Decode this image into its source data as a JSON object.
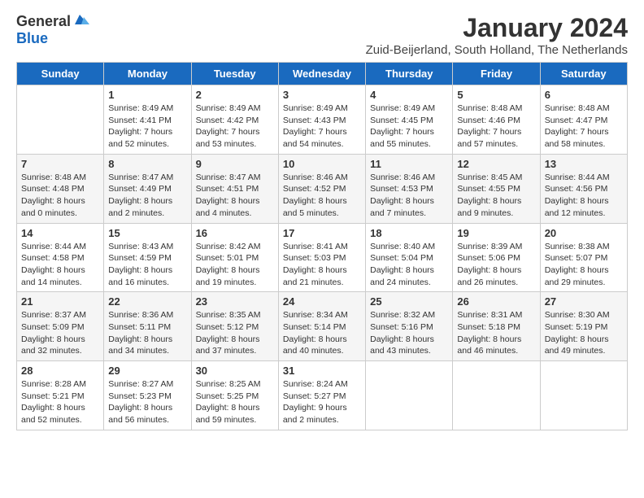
{
  "header": {
    "logo_general": "General",
    "logo_blue": "Blue",
    "month_title": "January 2024",
    "location": "Zuid-Beijerland, South Holland, The Netherlands"
  },
  "weekdays": [
    "Sunday",
    "Monday",
    "Tuesday",
    "Wednesday",
    "Thursday",
    "Friday",
    "Saturday"
  ],
  "weeks": [
    [
      {
        "day": "",
        "sunrise": "",
        "sunset": "",
        "daylight": ""
      },
      {
        "day": "1",
        "sunrise": "Sunrise: 8:49 AM",
        "sunset": "Sunset: 4:41 PM",
        "daylight": "Daylight: 7 hours and 52 minutes."
      },
      {
        "day": "2",
        "sunrise": "Sunrise: 8:49 AM",
        "sunset": "Sunset: 4:42 PM",
        "daylight": "Daylight: 7 hours and 53 minutes."
      },
      {
        "day": "3",
        "sunrise": "Sunrise: 8:49 AM",
        "sunset": "Sunset: 4:43 PM",
        "daylight": "Daylight: 7 hours and 54 minutes."
      },
      {
        "day": "4",
        "sunrise": "Sunrise: 8:49 AM",
        "sunset": "Sunset: 4:45 PM",
        "daylight": "Daylight: 7 hours and 55 minutes."
      },
      {
        "day": "5",
        "sunrise": "Sunrise: 8:48 AM",
        "sunset": "Sunset: 4:46 PM",
        "daylight": "Daylight: 7 hours and 57 minutes."
      },
      {
        "day": "6",
        "sunrise": "Sunrise: 8:48 AM",
        "sunset": "Sunset: 4:47 PM",
        "daylight": "Daylight: 7 hours and 58 minutes."
      }
    ],
    [
      {
        "day": "7",
        "sunrise": "Sunrise: 8:48 AM",
        "sunset": "Sunset: 4:48 PM",
        "daylight": "Daylight: 8 hours and 0 minutes."
      },
      {
        "day": "8",
        "sunrise": "Sunrise: 8:47 AM",
        "sunset": "Sunset: 4:49 PM",
        "daylight": "Daylight: 8 hours and 2 minutes."
      },
      {
        "day": "9",
        "sunrise": "Sunrise: 8:47 AM",
        "sunset": "Sunset: 4:51 PM",
        "daylight": "Daylight: 8 hours and 4 minutes."
      },
      {
        "day": "10",
        "sunrise": "Sunrise: 8:46 AM",
        "sunset": "Sunset: 4:52 PM",
        "daylight": "Daylight: 8 hours and 5 minutes."
      },
      {
        "day": "11",
        "sunrise": "Sunrise: 8:46 AM",
        "sunset": "Sunset: 4:53 PM",
        "daylight": "Daylight: 8 hours and 7 minutes."
      },
      {
        "day": "12",
        "sunrise": "Sunrise: 8:45 AM",
        "sunset": "Sunset: 4:55 PM",
        "daylight": "Daylight: 8 hours and 9 minutes."
      },
      {
        "day": "13",
        "sunrise": "Sunrise: 8:44 AM",
        "sunset": "Sunset: 4:56 PM",
        "daylight": "Daylight: 8 hours and 12 minutes."
      }
    ],
    [
      {
        "day": "14",
        "sunrise": "Sunrise: 8:44 AM",
        "sunset": "Sunset: 4:58 PM",
        "daylight": "Daylight: 8 hours and 14 minutes."
      },
      {
        "day": "15",
        "sunrise": "Sunrise: 8:43 AM",
        "sunset": "Sunset: 4:59 PM",
        "daylight": "Daylight: 8 hours and 16 minutes."
      },
      {
        "day": "16",
        "sunrise": "Sunrise: 8:42 AM",
        "sunset": "Sunset: 5:01 PM",
        "daylight": "Daylight: 8 hours and 19 minutes."
      },
      {
        "day": "17",
        "sunrise": "Sunrise: 8:41 AM",
        "sunset": "Sunset: 5:03 PM",
        "daylight": "Daylight: 8 hours and 21 minutes."
      },
      {
        "day": "18",
        "sunrise": "Sunrise: 8:40 AM",
        "sunset": "Sunset: 5:04 PM",
        "daylight": "Daylight: 8 hours and 24 minutes."
      },
      {
        "day": "19",
        "sunrise": "Sunrise: 8:39 AM",
        "sunset": "Sunset: 5:06 PM",
        "daylight": "Daylight: 8 hours and 26 minutes."
      },
      {
        "day": "20",
        "sunrise": "Sunrise: 8:38 AM",
        "sunset": "Sunset: 5:07 PM",
        "daylight": "Daylight: 8 hours and 29 minutes."
      }
    ],
    [
      {
        "day": "21",
        "sunrise": "Sunrise: 8:37 AM",
        "sunset": "Sunset: 5:09 PM",
        "daylight": "Daylight: 8 hours and 32 minutes."
      },
      {
        "day": "22",
        "sunrise": "Sunrise: 8:36 AM",
        "sunset": "Sunset: 5:11 PM",
        "daylight": "Daylight: 8 hours and 34 minutes."
      },
      {
        "day": "23",
        "sunrise": "Sunrise: 8:35 AM",
        "sunset": "Sunset: 5:12 PM",
        "daylight": "Daylight: 8 hours and 37 minutes."
      },
      {
        "day": "24",
        "sunrise": "Sunrise: 8:34 AM",
        "sunset": "Sunset: 5:14 PM",
        "daylight": "Daylight: 8 hours and 40 minutes."
      },
      {
        "day": "25",
        "sunrise": "Sunrise: 8:32 AM",
        "sunset": "Sunset: 5:16 PM",
        "daylight": "Daylight: 8 hours and 43 minutes."
      },
      {
        "day": "26",
        "sunrise": "Sunrise: 8:31 AM",
        "sunset": "Sunset: 5:18 PM",
        "daylight": "Daylight: 8 hours and 46 minutes."
      },
      {
        "day": "27",
        "sunrise": "Sunrise: 8:30 AM",
        "sunset": "Sunset: 5:19 PM",
        "daylight": "Daylight: 8 hours and 49 minutes."
      }
    ],
    [
      {
        "day": "28",
        "sunrise": "Sunrise: 8:28 AM",
        "sunset": "Sunset: 5:21 PM",
        "daylight": "Daylight: 8 hours and 52 minutes."
      },
      {
        "day": "29",
        "sunrise": "Sunrise: 8:27 AM",
        "sunset": "Sunset: 5:23 PM",
        "daylight": "Daylight: 8 hours and 56 minutes."
      },
      {
        "day": "30",
        "sunrise": "Sunrise: 8:25 AM",
        "sunset": "Sunset: 5:25 PM",
        "daylight": "Daylight: 8 hours and 59 minutes."
      },
      {
        "day": "31",
        "sunrise": "Sunrise: 8:24 AM",
        "sunset": "Sunset: 5:27 PM",
        "daylight": "Daylight: 9 hours and 2 minutes."
      },
      {
        "day": "",
        "sunrise": "",
        "sunset": "",
        "daylight": ""
      },
      {
        "day": "",
        "sunrise": "",
        "sunset": "",
        "daylight": ""
      },
      {
        "day": "",
        "sunrise": "",
        "sunset": "",
        "daylight": ""
      }
    ]
  ]
}
